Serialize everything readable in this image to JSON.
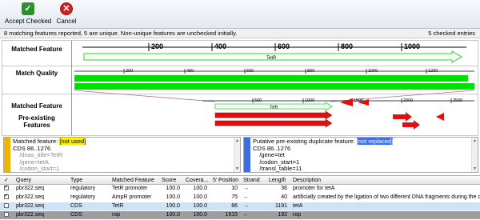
{
  "toolbar": {
    "accept_label": "Accept Checked",
    "cancel_label": "Cancel"
  },
  "status": {
    "message": "8 matching features reported, 5 are unique. Non-unique features are unchecked initially.",
    "checked": "5 checked entries"
  },
  "map": {
    "matched_feature_label": "Matched Feature",
    "match_quality_label": "Match Quality",
    "matched_feature_label_2": "Matched Feature",
    "preexisting_label": "Pre-existing Features",
    "top_ruler_ticks": [
      "200",
      "400",
      "600",
      "800",
      "1000"
    ],
    "quality_ruler_ticks": [
      "200",
      "400",
      "600",
      "800",
      "1000",
      "1200"
    ],
    "bottom_ruler_ticks": [
      "500",
      "1000",
      "1500",
      "2000",
      "2500"
    ],
    "matched_arrow_label": "TetR",
    "bottom_arrow_label": "TetR",
    "colors": {
      "feature_arrow": "#33cc33",
      "quality_bar": "#00e000",
      "preexisting_arrow": "#e01010"
    }
  },
  "left_pane": {
    "line1_prefix": "Matched feature: ",
    "line1_tag": "[not used]",
    "lines": [
      "CDS 86..1276",
      "    /dnas_title=TetR",
      "    /gene=tetA",
      "    /codon_start=1"
    ]
  },
  "right_pane": {
    "line1_prefix": "Putative pre-existing duplicate feature: ",
    "line1_tag": "[not replaced]",
    "lines": [
      "CDS 86..1276",
      "    /gene=tet",
      "    /codon_start=1",
      "    /transl_table=11"
    ]
  },
  "table": {
    "headers": {
      "check": "✓",
      "query": "Query",
      "type": "Type",
      "feature": "Matched Feature",
      "score": "Score",
      "coverage": "Covera...",
      "position": "5' Position",
      "strand": "Strand",
      "length": "Length",
      "description": "Description"
    },
    "rows": [
      {
        "checked": true,
        "query": "pbr322.seq",
        "type": "regulatory",
        "feature": "TetR promoter",
        "score": "100.0",
        "coverage": "100.0",
        "position": "10",
        "strand": "→",
        "length": "36",
        "description": "promoter for tetA"
      },
      {
        "checked": true,
        "query": "pbr322.seq",
        "type": "regulatory",
        "feature": "AmpR promoter",
        "score": "100.0",
        "coverage": "100.0",
        "position": "75",
        "strand": "←",
        "length": "40",
        "description": "artificially created by the ligation of two different DNA fragments during the constr"
      },
      {
        "checked": false,
        "query": "pbr322.seq",
        "type": "CDS",
        "feature": "TetR",
        "score": "100.0",
        "coverage": "100.0",
        "position": "86",
        "strand": "→",
        "length": "1191",
        "description": "tetA"
      },
      {
        "checked": false,
        "query": "pbr322.seq",
        "type": "CDS",
        "feature": "rop",
        "score": "100.0",
        "coverage": "100.0",
        "position": "1915",
        "strand": "←",
        "length": "192",
        "description": "rop"
      }
    ]
  }
}
